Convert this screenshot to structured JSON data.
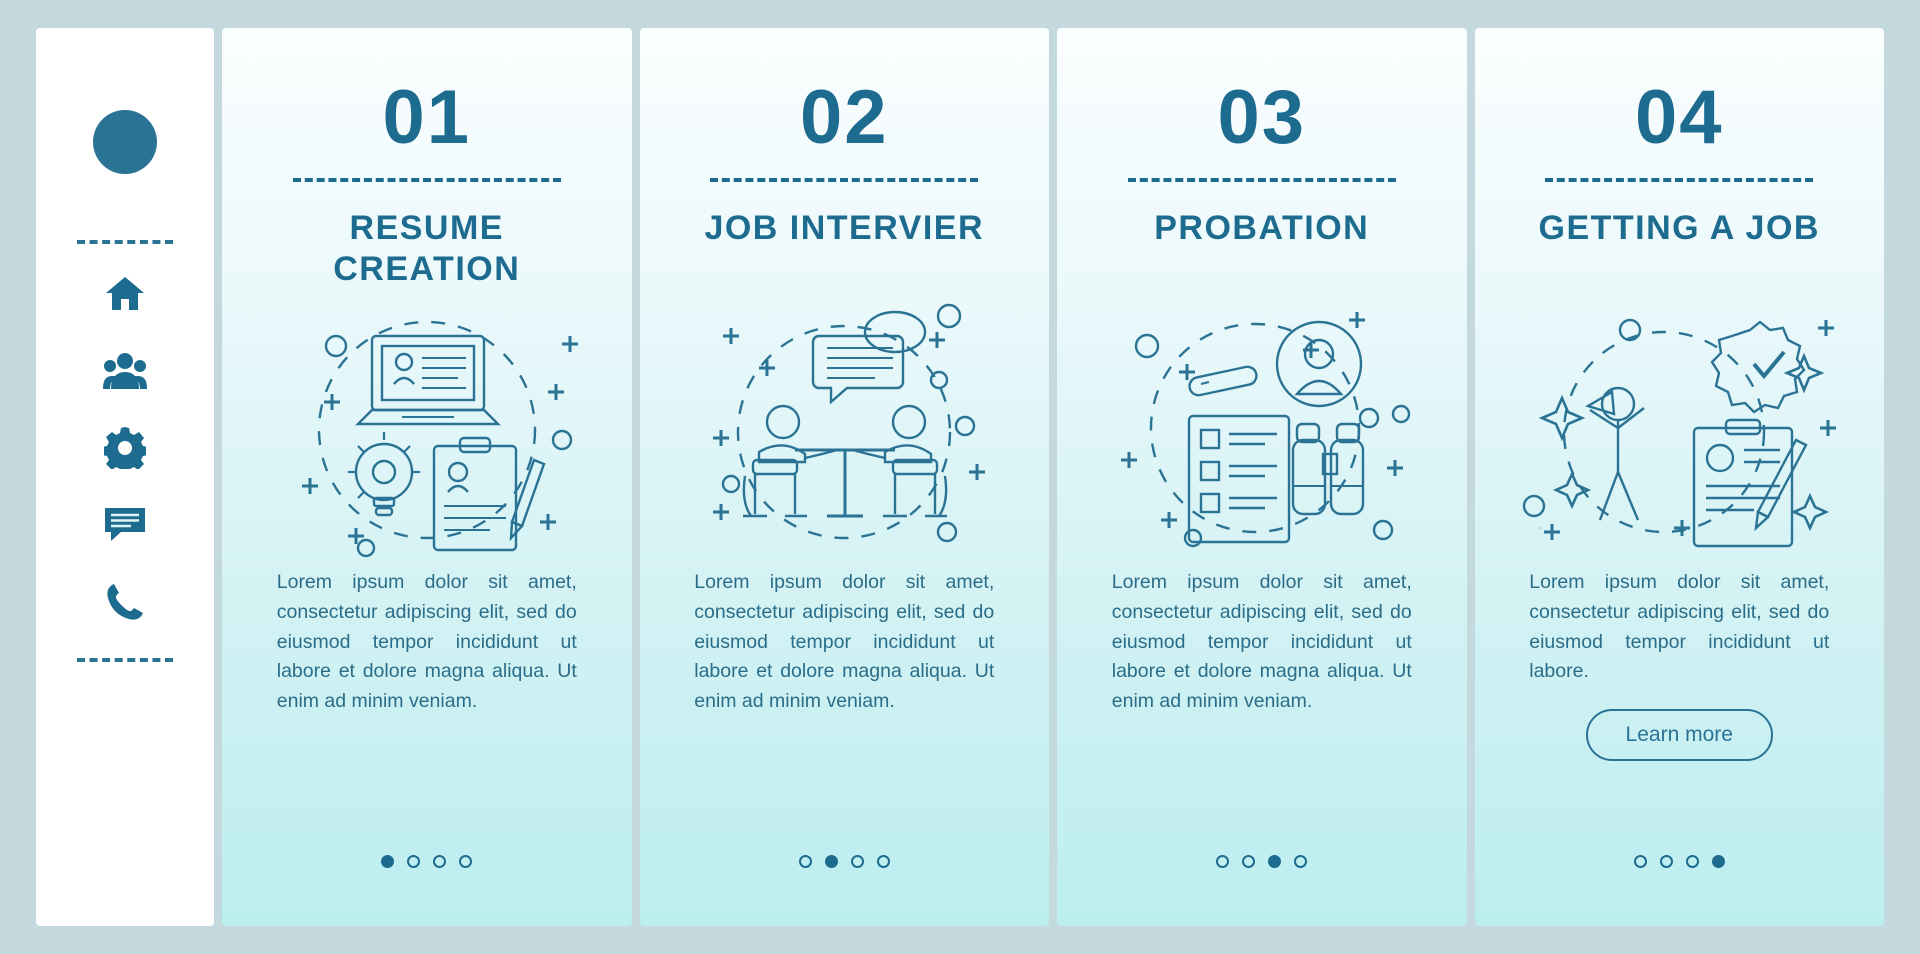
{
  "sidebar": {
    "logo_icon": "circle-logo",
    "divider_top": "dashed-divider",
    "divider_bottom": "dashed-divider",
    "icons": [
      {
        "name": "home-icon",
        "label": "Home"
      },
      {
        "name": "people-group-icon",
        "label": "Team"
      },
      {
        "name": "gear-icon",
        "label": "Settings"
      },
      {
        "name": "chat-icon",
        "label": "Messages"
      },
      {
        "name": "phone-icon",
        "label": "Contact"
      }
    ]
  },
  "accent_color": "#1d6b8f",
  "background_color": "#c3d9dd",
  "cards": [
    {
      "number": "01",
      "title": "RESUME CREATION",
      "body": "Lorem ipsum dolor sit amet, consectetur adipiscing elit, sed do eiusmod tempor incididunt ut labore et dolore magna aliqua. Ut enim ad minim veniam.",
      "illustration": "laptop-resume-lightbulb-clipboard",
      "dots": {
        "count": 4,
        "active_index": 0
      },
      "cta": null
    },
    {
      "number": "02",
      "title": "JOB INTERVIER",
      "body": "Lorem ipsum dolor sit amet, consectetur adipiscing elit, sed do eiusmod tempor incididunt ut labore et dolore magna aliqua. Ut enim ad minim veniam.",
      "illustration": "two-people-table-speech-bubbles",
      "dots": {
        "count": 4,
        "active_index": 1
      },
      "cta": null
    },
    {
      "number": "03",
      "title": "PROBATION",
      "body": "Lorem ipsum dolor sit amet, consectetur adipiscing elit, sed do eiusmod tempor incididunt ut labore et dolore magna aliqua. Ut enim ad minim veniam.",
      "illustration": "checklist-avatar-binoculars",
      "dots": {
        "count": 4,
        "active_index": 2
      },
      "cta": null
    },
    {
      "number": "04",
      "title": "GETTING A JOB",
      "body": "Lorem ipsum dolor sit amet, consectetur adipiscing elit, sed do eiusmod tempor incididunt ut labore.",
      "illustration": "happy-person-badge-contract",
      "dots": {
        "count": 4,
        "active_index": 3
      },
      "cta": {
        "label": "Learn more"
      }
    }
  ]
}
